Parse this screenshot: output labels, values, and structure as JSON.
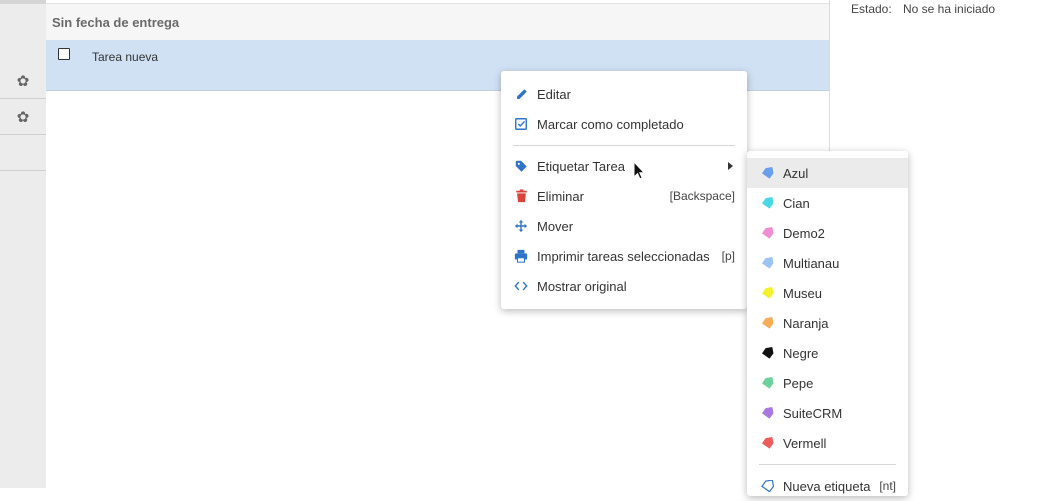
{
  "task_list": {
    "section_title": "Sin fecha de entrega",
    "tasks": [
      {
        "name": "Tarea nueva",
        "completed": false,
        "selected": true
      }
    ]
  },
  "task_details": {
    "status_label": "Estado:",
    "status_value": "No se ha iniciado"
  },
  "context_menu": {
    "items": [
      {
        "label": "Editar",
        "icon": "pencil-icon"
      },
      {
        "label": "Marcar como completado",
        "icon": "check-square-icon"
      },
      {
        "label": "Etiquetar Tarea",
        "icon": "tag-icon",
        "has_submenu": true
      },
      {
        "label": "Eliminar",
        "icon": "trash-icon",
        "shortcut": "[Backspace]"
      },
      {
        "label": "Mover",
        "icon": "move-icon"
      },
      {
        "label": "Imprimir tareas seleccionadas",
        "icon": "printer-icon",
        "shortcut": "[p]"
      },
      {
        "label": "Mostrar original",
        "icon": "code-icon"
      }
    ]
  },
  "tag_submenu": {
    "tags": [
      {
        "label": "Azul",
        "color": "#6b9ded"
      },
      {
        "label": "Cian",
        "color": "#4ad8e6"
      },
      {
        "label": "Demo2",
        "color": "#ef8ed3"
      },
      {
        "label": "Multianau",
        "color": "#9dc3f2"
      },
      {
        "label": "Museu",
        "color": "#f4f22e"
      },
      {
        "label": "Naranja",
        "color": "#f7ad57"
      },
      {
        "label": "Negre",
        "color": "#111111"
      },
      {
        "label": "Pepe",
        "color": "#6ed19b"
      },
      {
        "label": "SuiteCRM",
        "color": "#a878de"
      },
      {
        "label": "Vermell",
        "color": "#ed5b5b"
      }
    ],
    "new_tag_label": "Nueva etiqueta",
    "new_tag_shortcut": "[nt]"
  },
  "colors": {
    "icon_blue": "#2f74c8",
    "icon_red": "#d9443b",
    "selected_row": "#d1e1f4"
  }
}
